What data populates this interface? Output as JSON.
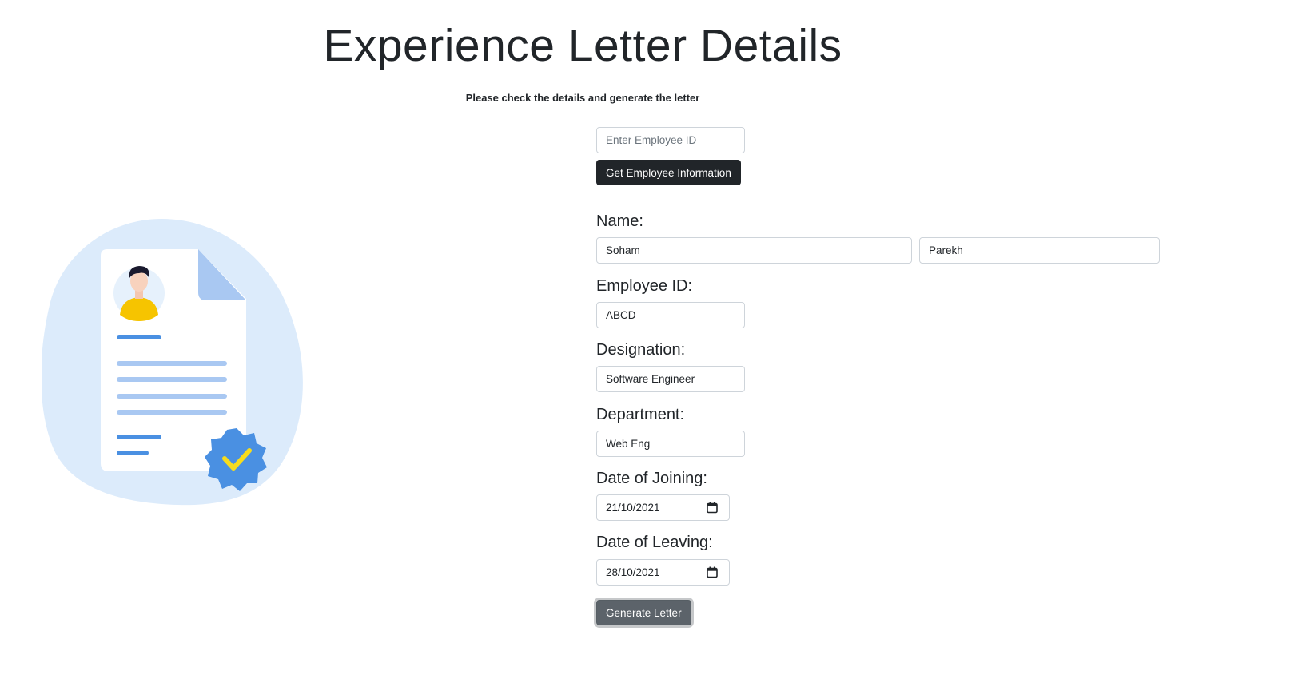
{
  "header": {
    "title": "Experience Letter Details",
    "subtitle": "Please check the details and generate the letter"
  },
  "lookup": {
    "employee_id_placeholder": "Enter Employee ID",
    "employee_id_value": "",
    "get_info_label": "Get Employee Information"
  },
  "form": {
    "name_label": "Name:",
    "first_name": "Soham",
    "last_name": "Parekh",
    "employee_id_label": "Employee ID:",
    "employee_id": "ABCD",
    "designation_label": "Designation:",
    "designation": "Software Engineer",
    "department_label": "Department:",
    "department": "Web Eng",
    "joining_label": "Date of Joining:",
    "joining_date": "21/10/2021",
    "leaving_label": "Date of Leaving:",
    "leaving_date": "28/10/2021",
    "generate_label": "Generate Letter"
  },
  "icons": {
    "illustration": "resume-document-illustration",
    "calendar": "calendar-icon"
  },
  "colors": {
    "blob": "#dcebfb",
    "accent_blue": "#4a90e2",
    "light_blue": "#a9c8f2",
    "badge_check": "#f7dc1c",
    "avatar_shirt": "#f6c400"
  }
}
